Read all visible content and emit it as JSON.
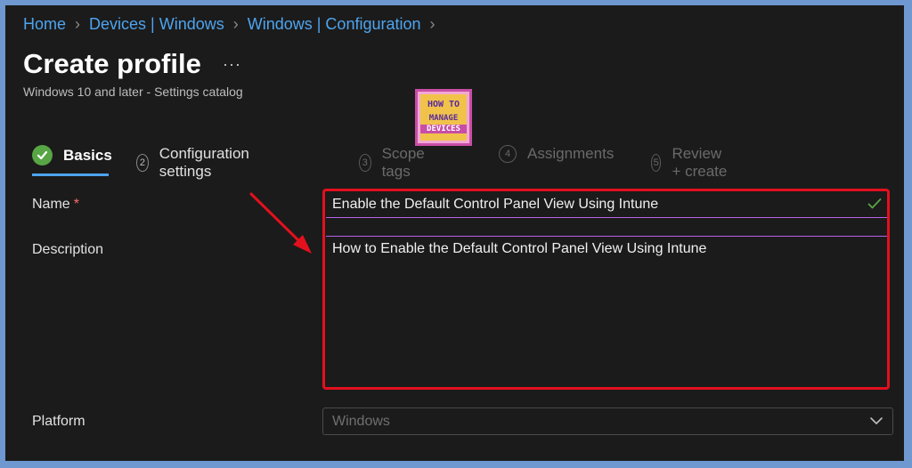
{
  "breadcrumb": [
    "Home",
    "Devices | Windows",
    "Windows | Configuration"
  ],
  "title": "Create profile",
  "more_label": "···",
  "subtitle": "Windows 10 and later - Settings catalog",
  "logo": {
    "line1": "HOW TO",
    "line2": "MANAGE",
    "line3": "DEVICES"
  },
  "steps": [
    {
      "num": "1",
      "label": "Basics",
      "state": "complete"
    },
    {
      "num": "2",
      "label": "Configuration settings",
      "state": "enabled"
    },
    {
      "num": "3",
      "label": "Scope tags",
      "state": "disabled"
    },
    {
      "num": "4",
      "label": "Assignments",
      "state": "disabled"
    },
    {
      "num": "5",
      "label": "Review + create",
      "state": "disabled"
    }
  ],
  "form": {
    "name_label": "Name",
    "required_mark": "*",
    "name_value": "Enable the Default Control Panel View Using Intune",
    "description_label": "Description",
    "description_value": "How to Enable the Default Control Panel View Using Intune",
    "platform_label": "Platform",
    "platform_value": "Windows"
  },
  "colors": {
    "accent": "#4ea4ef",
    "success": "#57a545",
    "highlight": "#e3101e",
    "focus": "#b860e8"
  },
  "icons": {
    "complete": "check-circle-icon",
    "valid": "checkmark-icon",
    "dropdown": "chevron-down-icon",
    "annotation": "red-arrow-icon"
  }
}
